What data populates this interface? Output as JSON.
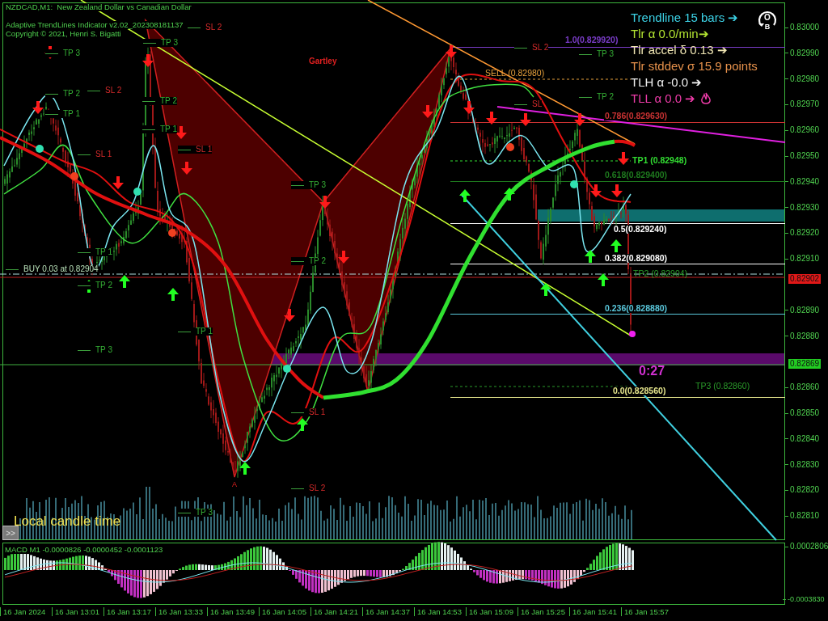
{
  "chart_header": {
    "symbol": "NZDCAD,M1:  New Zealand Dollar vs Canadian Dollar",
    "indicator": "Adaptive TrendLines Indicator v2.02_202308181137",
    "copyright": "Copyright © 2021, Henri S. Bigatti"
  },
  "logo_letters": [
    "O",
    "B"
  ],
  "info_panel": [
    {
      "text": "Trendline 15 bars ➔",
      "color": "#3cd2e6"
    },
    {
      "text": "Tlr α 0.0/min➔",
      "color": "#b4e632"
    },
    {
      "text": "Tlr accel δ 0.13 ➔",
      "color": "#f0e6b4"
    },
    {
      "text": "Tlr stddev σ 15.9 points",
      "color": "#e6914b"
    },
    {
      "text": "TLH α -0.0 ➔",
      "color": "#f0f0f0"
    },
    {
      "text": "TLL α 0.0 ➔",
      "color": "#f03caa"
    }
  ],
  "pattern": {
    "name": "Gartley",
    "point": "A"
  },
  "fib_levels": [
    {
      "label": "1.0(0.829920)",
      "color": "#7a3cc8"
    },
    {
      "label": "0.786(0.829630)",
      "color": "#c83232"
    },
    {
      "label": "0.618(0.829400)",
      "color": "#1e7a1e"
    },
    {
      "label": "0.5(0.829240)",
      "color": "#ffffff"
    },
    {
      "label": "0.382(0.829080)",
      "color": "#ffffff"
    },
    {
      "label": "0.236(0.828880)",
      "color": "#5ac8dc"
    },
    {
      "label": "0.0(0.828560)",
      "color": "#e6e68c"
    }
  ],
  "trade_levels": [
    {
      "label": "SELL (0.82980)",
      "color": "#e6a03c"
    },
    {
      "label": "TP1 (0.82948)",
      "color": "#32dc32"
    },
    {
      "label": "TP2 (0.82904)",
      "color": "#2a9a2a"
    },
    {
      "label": "TP3 (0.82860)",
      "color": "#2a9a2a"
    }
  ],
  "level_labels": [
    {
      "text": "TP 3",
      "kind": "tp"
    },
    {
      "text": "SL 2",
      "kind": "sl"
    },
    {
      "text": "TP 3",
      "kind": "tp"
    },
    {
      "text": "TP 2",
      "kind": "tp"
    },
    {
      "text": "SL 2",
      "kind": "sl"
    },
    {
      "text": "TP 1",
      "kind": "tp"
    },
    {
      "text": "TP 2",
      "kind": "tp"
    },
    {
      "text": "TP 1",
      "kind": "tp"
    },
    {
      "text": "SL 1",
      "kind": "sl"
    },
    {
      "text": "SL 1",
      "kind": "sl"
    },
    {
      "text": "TP 1",
      "kind": "tp"
    },
    {
      "text": "TP 2",
      "kind": "tp"
    },
    {
      "text": "TP 3",
      "kind": "tp"
    },
    {
      "text": "TP 1",
      "kind": "tp"
    },
    {
      "text": "TP 3",
      "kind": "tp"
    },
    {
      "text": "TP 2",
      "kind": "tp"
    },
    {
      "text": "SL 1",
      "kind": "sl"
    },
    {
      "text": "SL 2",
      "kind": "sl"
    },
    {
      "text": "TP 3",
      "kind": "tp"
    },
    {
      "text": "TP 3",
      "kind": "tp"
    },
    {
      "text": "TP 2",
      "kind": "tp"
    },
    {
      "text": "SL",
      "kind": "sl"
    },
    {
      "text": "SL 2",
      "kind": "sl"
    }
  ],
  "position_label": "BUY 0.03 at 0.82904",
  "countdown": "0:27",
  "candle_time_label": "Local candle time",
  "scroll_button": ">>",
  "price_axis": [
    "0.83000",
    "0.82990",
    "0.82980",
    "0.82970",
    "0.82960",
    "0.82950",
    "0.82940",
    "0.82930",
    "0.82920",
    "0.82910",
    "0.82890",
    "0.82880",
    "0.82860",
    "0.82850",
    "0.82840",
    "0.82830",
    "0.82820",
    "0.82810"
  ],
  "price_tags": [
    {
      "text": "0.82902",
      "kind": "bid"
    },
    {
      "text": "0.82869",
      "kind": "last"
    }
  ],
  "macd": {
    "label": "MACD M1 -0.0000826 -0.0000452 -0.0001123",
    "scale": [
      "0.0002806",
      "-0.0003830"
    ]
  },
  "time_axis": [
    "16 Jan 2024",
    "16 Jan 13:01",
    "16 Jan 13:17",
    "16 Jan 13:33",
    "16 Jan 13:49",
    "16 Jan 14:05",
    "16 Jan 14:21",
    "16 Jan 14:37",
    "16 Jan 14:53",
    "16 Jan 15:09",
    "16 Jan 15:25",
    "16 Jan 15:41",
    "16 Jan 15:57"
  ]
}
